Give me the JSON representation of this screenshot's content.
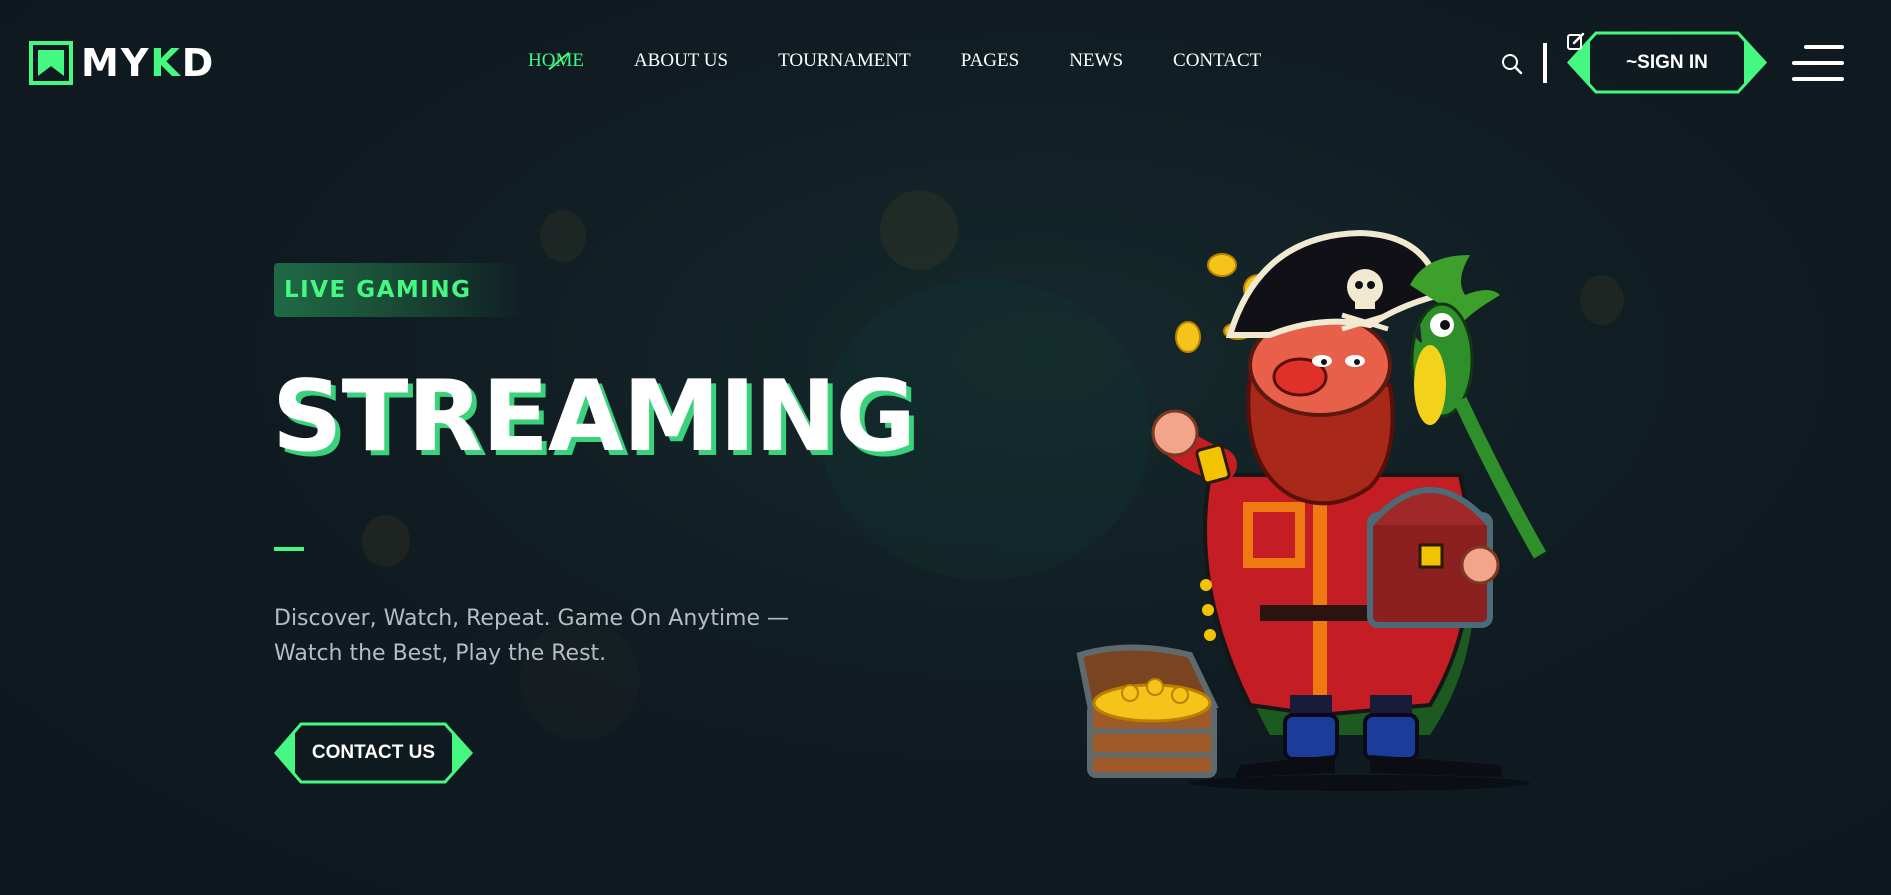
{
  "brand": {
    "logo_text_main": "MY",
    "logo_text_accent": "K",
    "logo_text_end": "D",
    "accent_color": "#45f882",
    "background_color": "#101c22"
  },
  "nav": {
    "items": [
      {
        "label": "HOME",
        "active": true
      },
      {
        "label": "ABOUT US",
        "active": false
      },
      {
        "label": "TOURNAMENT",
        "active": false
      },
      {
        "label": "PAGES",
        "active": false
      },
      {
        "label": "NEWS",
        "active": false
      },
      {
        "label": "CONTACT",
        "active": false
      }
    ]
  },
  "header_actions": {
    "search_icon": "search-icon",
    "signin_label": "~SIGN IN",
    "signin_icon": "edit-icon",
    "menu_icon": "hamburger-menu-icon"
  },
  "hero": {
    "tag": "LIVE GAMING",
    "title": "STREAMING",
    "description": "Discover, Watch, Repeat. Game On Anytime — Watch the Best, Play the Rest.",
    "cta_label": "CONTACT US",
    "illustration": "pirate-with-parrot-and-treasure-chest"
  }
}
